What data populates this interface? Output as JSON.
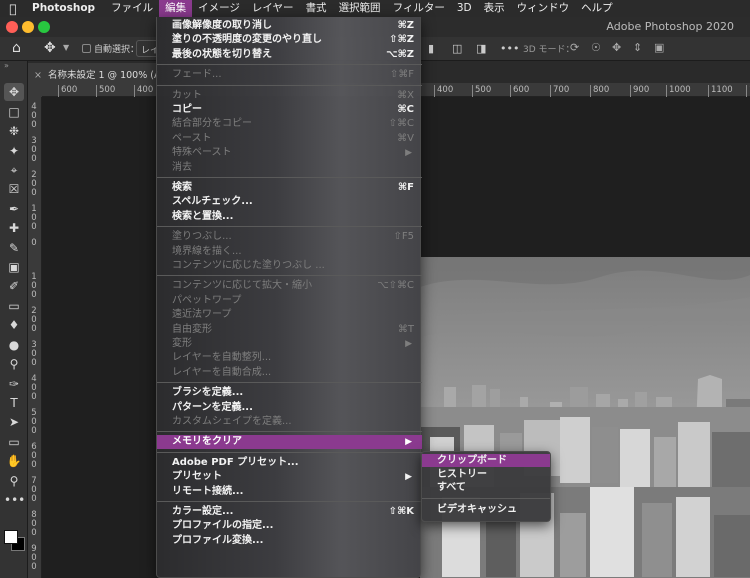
{
  "menubar": {
    "items": [
      {
        "label": "Photoshop",
        "app": true
      },
      {
        "label": "ファイル"
      },
      {
        "label": "編集",
        "active": true
      },
      {
        "label": "イメージ"
      },
      {
        "label": "レイヤー"
      },
      {
        "label": "書式"
      },
      {
        "label": "選択範囲"
      },
      {
        "label": "フィルター"
      },
      {
        "label": "3D"
      },
      {
        "label": "表示"
      },
      {
        "label": "ウィンドウ"
      },
      {
        "label": "ヘルプ"
      }
    ]
  },
  "window": {
    "title": "Adobe Photoshop 2020"
  },
  "options_bar": {
    "auto_select_label": "自動選択：",
    "layer_select_value": "レイ",
    "mode_3d_label": "3D モード："
  },
  "document_tab": {
    "title": "名称未設定 1 @ 100% (Ad"
  },
  "ruler": {
    "h_ticks": [
      "600",
      "500",
      "400",
      "400",
      "500",
      "600",
      "700",
      "800",
      "900",
      "1000",
      "1100",
      "120"
    ],
    "v_ticks": [
      "4 0 0",
      "3 0 0",
      "2 0 0",
      "1 0 0",
      "0",
      "1 0 0",
      "2 0 0",
      "3 0 0",
      "4 0 0",
      "5 0 0",
      "6 0 0",
      "7 0 0",
      "8 0 0",
      "9 0 0"
    ]
  },
  "edit_menu": {
    "items": [
      {
        "label": "画像解像度の取り消し",
        "shortcut": "⌘Z",
        "enabled": true
      },
      {
        "label": "塗りの不透明度の変更のやり直し",
        "shortcut": "⇧⌘Z",
        "enabled": true
      },
      {
        "label": "最後の状態を切り替え",
        "shortcut": "⌥⌘Z",
        "enabled": true
      },
      {
        "sep": true
      },
      {
        "label": "フェード...",
        "shortcut": "⇧⌘F",
        "enabled": false
      },
      {
        "sep": true
      },
      {
        "label": "カット",
        "shortcut": "⌘X",
        "enabled": false
      },
      {
        "label": "コピー",
        "shortcut": "⌘C",
        "enabled": true
      },
      {
        "label": "結合部分をコピー",
        "shortcut": "⇧⌘C",
        "enabled": false
      },
      {
        "label": "ペースト",
        "shortcut": "⌘V",
        "enabled": false
      },
      {
        "label": "特殊ペースト",
        "shortcut": "",
        "enabled": false,
        "submenu": true
      },
      {
        "label": "消去",
        "shortcut": "",
        "enabled": false
      },
      {
        "sep": true
      },
      {
        "label": "検索",
        "shortcut": "⌘F",
        "enabled": true
      },
      {
        "label": "スペルチェック...",
        "shortcut": "",
        "enabled": true
      },
      {
        "label": "検索と置換...",
        "shortcut": "",
        "enabled": true
      },
      {
        "sep": true
      },
      {
        "label": "塗りつぶし...",
        "shortcut": "⇧F5",
        "enabled": false
      },
      {
        "label": "境界線を描く...",
        "shortcut": "",
        "enabled": false
      },
      {
        "label": "コンテンツに応じた塗りつぶし ...",
        "shortcut": "",
        "enabled": false
      },
      {
        "sep": true
      },
      {
        "label": "コンテンツに応じて拡大・縮小",
        "shortcut": "⌥⇧⌘C",
        "enabled": false
      },
      {
        "label": "パペットワープ",
        "shortcut": "",
        "enabled": false
      },
      {
        "label": "遠近法ワープ",
        "shortcut": "",
        "enabled": false
      },
      {
        "label": "自由変形",
        "shortcut": "⌘T",
        "enabled": false
      },
      {
        "label": "変形",
        "shortcut": "",
        "enabled": false,
        "submenu": true
      },
      {
        "label": "レイヤーを自動整列...",
        "shortcut": "",
        "enabled": false
      },
      {
        "label": "レイヤーを自動合成...",
        "shortcut": "",
        "enabled": false
      },
      {
        "sep": true
      },
      {
        "label": "ブラシを定義...",
        "shortcut": "",
        "enabled": true
      },
      {
        "label": "パターンを定義...",
        "shortcut": "",
        "enabled": true
      },
      {
        "label": "カスタムシェイプを定義...",
        "shortcut": "",
        "enabled": false
      },
      {
        "sep": true
      },
      {
        "label": "メモリをクリア",
        "shortcut": "",
        "enabled": true,
        "submenu": true,
        "highlight": true
      },
      {
        "sep": true
      },
      {
        "label": "Adobe PDF プリセット...",
        "shortcut": "",
        "enabled": true
      },
      {
        "label": "プリセット",
        "shortcut": "",
        "enabled": true,
        "submenu": true
      },
      {
        "label": "リモート接続...",
        "shortcut": "",
        "enabled": true
      },
      {
        "sep": true
      },
      {
        "label": "カラー設定...",
        "shortcut": "⇧⌘K",
        "enabled": true
      },
      {
        "label": "プロファイルの指定...",
        "shortcut": "",
        "enabled": true
      },
      {
        "label": "プロファイル変換...",
        "shortcut": "",
        "enabled": true
      }
    ]
  },
  "purge_submenu": {
    "items": [
      {
        "label": "クリップボード",
        "highlight": true
      },
      {
        "label": "ヒストリー"
      },
      {
        "label": "すべて"
      },
      {
        "sep": true
      },
      {
        "label": "ビデオキャッシュ"
      }
    ]
  },
  "colors": {
    "highlight": "#8b3a8f",
    "menubar_bg": "#2b2b2b",
    "canvas_bg": "#1f1f1f"
  }
}
